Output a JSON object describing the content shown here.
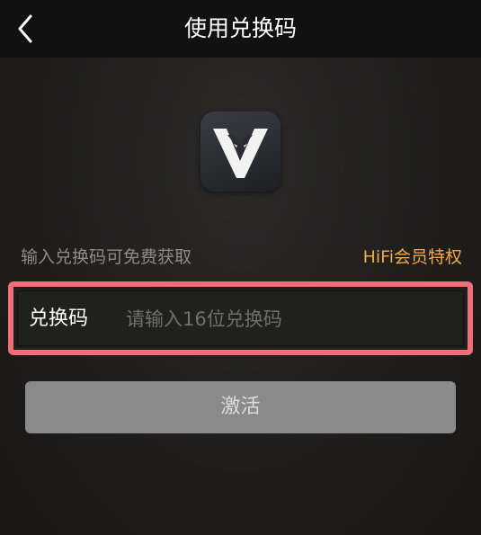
{
  "header": {
    "title": "使用兑换码",
    "back_icon": "chevron-left-icon"
  },
  "logo": {
    "icon": "viper-v-logo-icon"
  },
  "redeem": {
    "hint": "输入兑换码可免费获取",
    "privilege_link": "HiFi会员特权",
    "code_label": "兑换码",
    "code_value": "",
    "code_placeholder": "请输入16位兑换码",
    "activate_label": "激活"
  },
  "colors": {
    "accent_orange": "#f5a64a",
    "highlight_border": "#ef6f78",
    "button_disabled": "#8a8a8a"
  }
}
